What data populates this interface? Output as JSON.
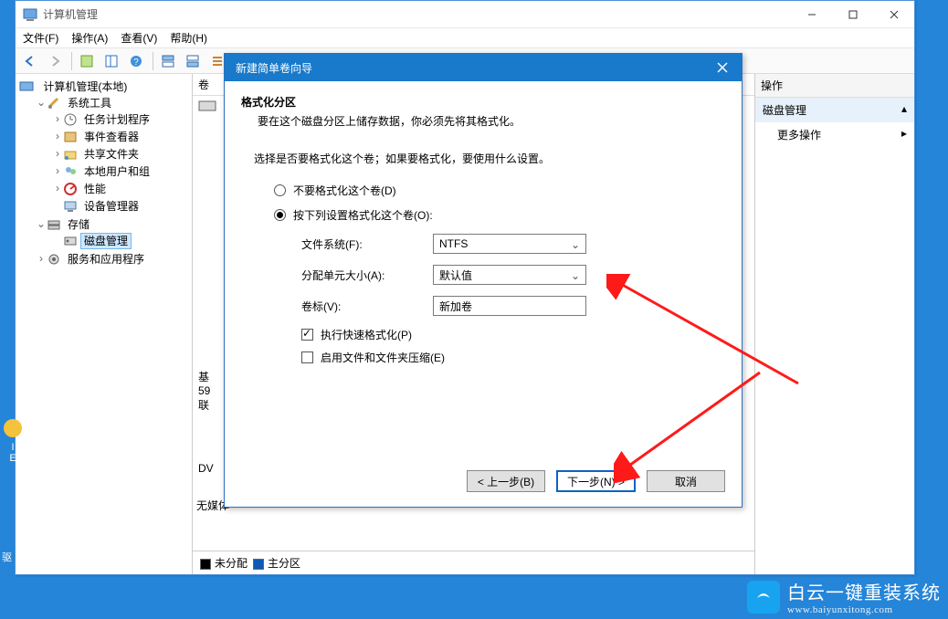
{
  "window": {
    "title": "计算机管理",
    "menu": {
      "file": "文件(F)",
      "action": "操作(A)",
      "view": "查看(V)",
      "help": "帮助(H)"
    }
  },
  "tree": {
    "root": "计算机管理(本地)",
    "system_tools": "系统工具",
    "items": {
      "task_sched": "任务计划程序",
      "event_viewer": "事件查看器",
      "shared_folders": "共享文件夹",
      "local_users": "本地用户和组",
      "perf": "性能",
      "devmgr": "设备管理器"
    },
    "storage": "存储",
    "disk_mgmt": "磁盘管理",
    "services": "服务和应用程序"
  },
  "center": {
    "col_volume": "卷",
    "disk_basic": "基",
    "disk_size": "59",
    "disk_online": "联",
    "dvd_label": "DV",
    "no_media": "无媒体",
    "legend_unalloc": "未分配",
    "legend_primary": "主分区"
  },
  "actions": {
    "header": "操作",
    "disk_mgmt": "磁盘管理",
    "more": "更多操作"
  },
  "wizard": {
    "title": "新建简单卷向导",
    "heading": "格式化分区",
    "subheading": "要在这个磁盘分区上储存数据，你必须先将其格式化。",
    "intro": "选择是否要格式化这个卷；如果要格式化，要使用什么设置。",
    "radio_no_format": "不要格式化这个卷(D)",
    "radio_format": "按下列设置格式化这个卷(O):",
    "label_fs": "文件系统(F):",
    "value_fs": "NTFS",
    "label_alloc": "分配单元大小(A):",
    "value_alloc": "默认值",
    "label_volname": "卷标(V):",
    "value_volname": "新加卷",
    "check_quick": "执行快速格式化(P)",
    "check_compress": "启用文件和文件夹压缩(E)",
    "btn_back": "< 上一步(B)",
    "btn_next": "下一步(N) >",
    "btn_cancel": "取消"
  },
  "watermark": {
    "big": "白云一键重装系统",
    "small": "www.baiyunxitong.com"
  },
  "desktop": {
    "label1": "I",
    "label2": "E",
    "label3": "驱"
  }
}
